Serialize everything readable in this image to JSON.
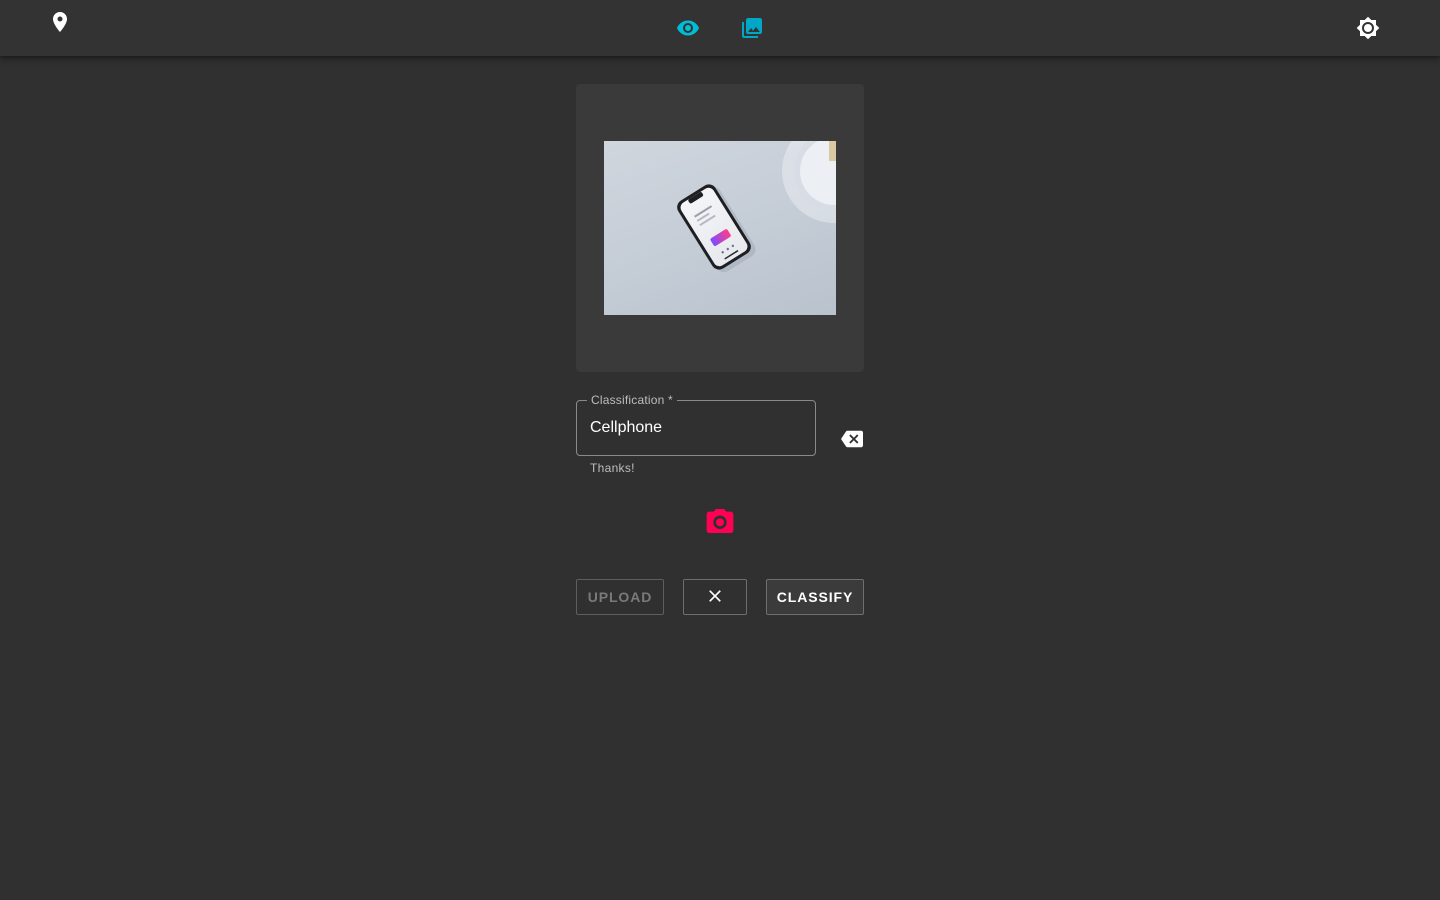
{
  "appbar": {
    "location_icon": "map-marker-icon",
    "tabs": [
      {
        "icon": "eye-icon",
        "color": "#00bcd4",
        "active": true
      },
      {
        "icon": "image-library-icon",
        "color": "#00a8c8",
        "active": false
      }
    ],
    "theme_toggle_icon": "brightness-icon"
  },
  "preview": {
    "image_alt": "Cellphone"
  },
  "classification_field": {
    "label": "Classification *",
    "value": "Cellphone",
    "helper_text": "Thanks!",
    "clear_icon": "backspace-icon"
  },
  "camera": {
    "icon": "camera-icon",
    "color": "#ff0055"
  },
  "actions": {
    "upload_label": "Upload",
    "clear_icon": "close-icon",
    "classify_label": "Classify"
  },
  "theme": {
    "background": "#303030",
    "appbar": "#333333",
    "accent": "#00bcd4",
    "camera": "#ff0055"
  }
}
